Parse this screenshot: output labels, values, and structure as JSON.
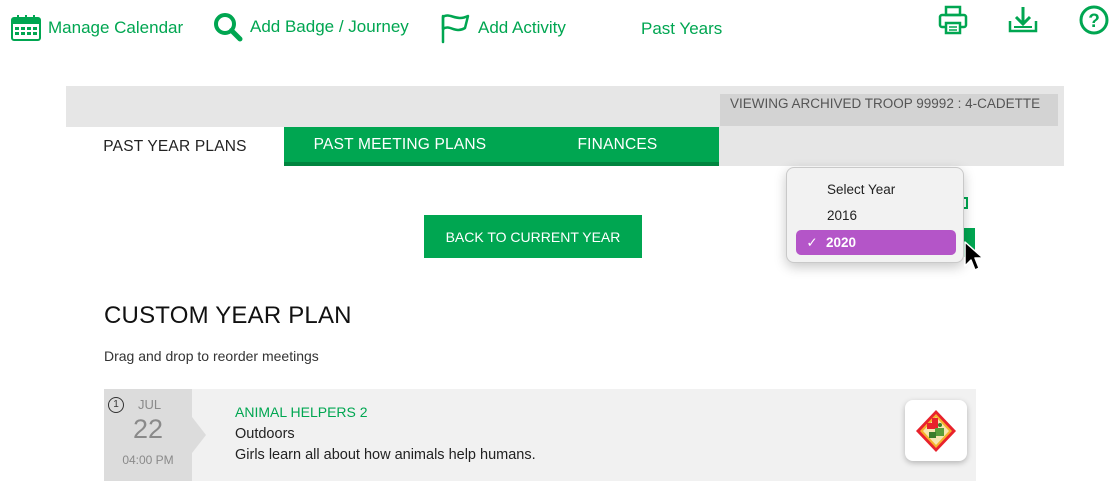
{
  "toolbar": {
    "manage_calendar": "Manage Calendar",
    "add_badge_journey": "Add Badge / Journey",
    "add_activity": "Add Activity",
    "past_years": "Past Years"
  },
  "banner": {
    "archived_text": "VIEWING ARCHIVED TROOP 99992 : 4-CADETTE"
  },
  "tabs": [
    {
      "label": "PAST YEAR PLANS",
      "active": true
    },
    {
      "label": "PAST MEETING PLANS",
      "active": false
    },
    {
      "label": "FINANCES",
      "active": false
    }
  ],
  "back_button_label": "BACK TO CURRENT YEAR",
  "year_dropdown": {
    "options": [
      "Select Year",
      "2016",
      "2020"
    ],
    "selected": "2020",
    "check_glyph": "✓"
  },
  "plan": {
    "title": "CUSTOM YEAR PLAN",
    "subtitle": "Drag and drop to reorder meetings"
  },
  "meetings": [
    {
      "number": "1",
      "month": "JUL",
      "day": "22",
      "time": "04:00 PM",
      "title": "ANIMAL HELPERS 2",
      "category": "Outdoors",
      "description": "Girls learn all about how animals help humans.",
      "badge_icon": "cadette-badge-icon"
    }
  ],
  "colors": {
    "brand_green": "#00a651",
    "dark_green": "#00853f",
    "selected_purple": "#b455c8",
    "tab_band": "#e6e6e6",
    "banner_gray": "#d3d3d3"
  },
  "icons": {
    "calendar": "calendar-icon",
    "search": "search-icon",
    "flag": "flag-icon",
    "print": "print-icon",
    "download": "download-icon",
    "help": "help-icon",
    "cursor": "mouse-pointer-icon"
  }
}
